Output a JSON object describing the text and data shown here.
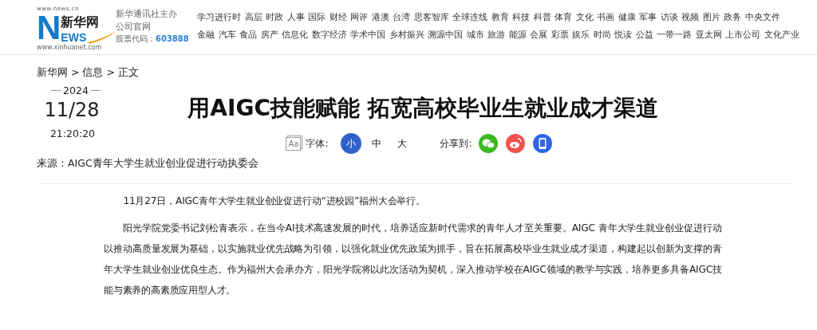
{
  "logo": {
    "top_url": "www.news.cn",
    "name": "新华网",
    "letter": "N",
    "letters": "EWS",
    "bottom_url": "www.xinhuanet.com"
  },
  "publisher": {
    "line1": "新华通讯社主办",
    "line2": "公司官网",
    "stock_label": "股票代码：",
    "stock_code": "603888"
  },
  "nav_rows": [
    [
      "学习进行时",
      "高层",
      "时政",
      "人事",
      "国际",
      "财经",
      "网评",
      "港澳",
      "台湾",
      "思客智库",
      "全球连线",
      "教育",
      "科技",
      "科普",
      "体育",
      "文化",
      "书画",
      "健康",
      "军事",
      "访谈",
      "视频",
      "图片",
      "政务",
      "中央文件"
    ],
    [
      "金融",
      "汽车",
      "食品",
      "房产",
      "信息化",
      "数字经济",
      "学术中国",
      "乡村振兴",
      "溯源中国",
      "城市",
      "旅游",
      "能源",
      "会展",
      "彩票",
      "娱乐",
      "时尚",
      "悦读",
      "公益",
      "一带一路",
      "亚太网",
      "上市公司",
      "文化产业"
    ]
  ],
  "breadcrumb": [
    "新华网",
    "信息",
    "正文"
  ],
  "breadcrumb_separator": ">",
  "date": {
    "year": "2024",
    "day": "11/28",
    "time": "21:20:20"
  },
  "title": "用AIGC技能赋能 拓宽高校毕业生就业成才渠道",
  "font_icon_label": "Aa",
  "font_label": "字体:",
  "font_sizes": [
    {
      "label": "小",
      "selected": true
    },
    {
      "label": "中",
      "selected": false
    },
    {
      "label": "大",
      "selected": false
    }
  ],
  "share_label": "分享到:",
  "share": [
    {
      "kind": "wechat",
      "color": "#3cb81f"
    },
    {
      "kind": "weibo",
      "color": "#f0524f"
    },
    {
      "kind": "mobile",
      "color": "#2f63e8"
    }
  ],
  "source": "来源：AIGC青年大学生就业创业促进行动执委会",
  "paragraphs": [
    "11月27日，AIGC青年大学生就业创业促进行动“进校园”福州大会举行。",
    "阳光学院党委书记刘松青表示，在当今AI技术高速发展的时代，培养适应新时代需求的青年人才至关重要。AIGC 青年大学生就业创业促进行动以推动高质量发展为基础，以实施就业优先战略为引领，以强化就业优先政策为抓手，旨在拓展高校毕业生就业成才渠道，构建起以创新为支撑的青年大学生就业创业优良生态。作为福州大会承办方，阳光学院将以此次活动为契机，深入推动学校在AIGC领域的教学与实践，培养更多具备AIGC技能与素养的高素质应用型人才。"
  ]
}
